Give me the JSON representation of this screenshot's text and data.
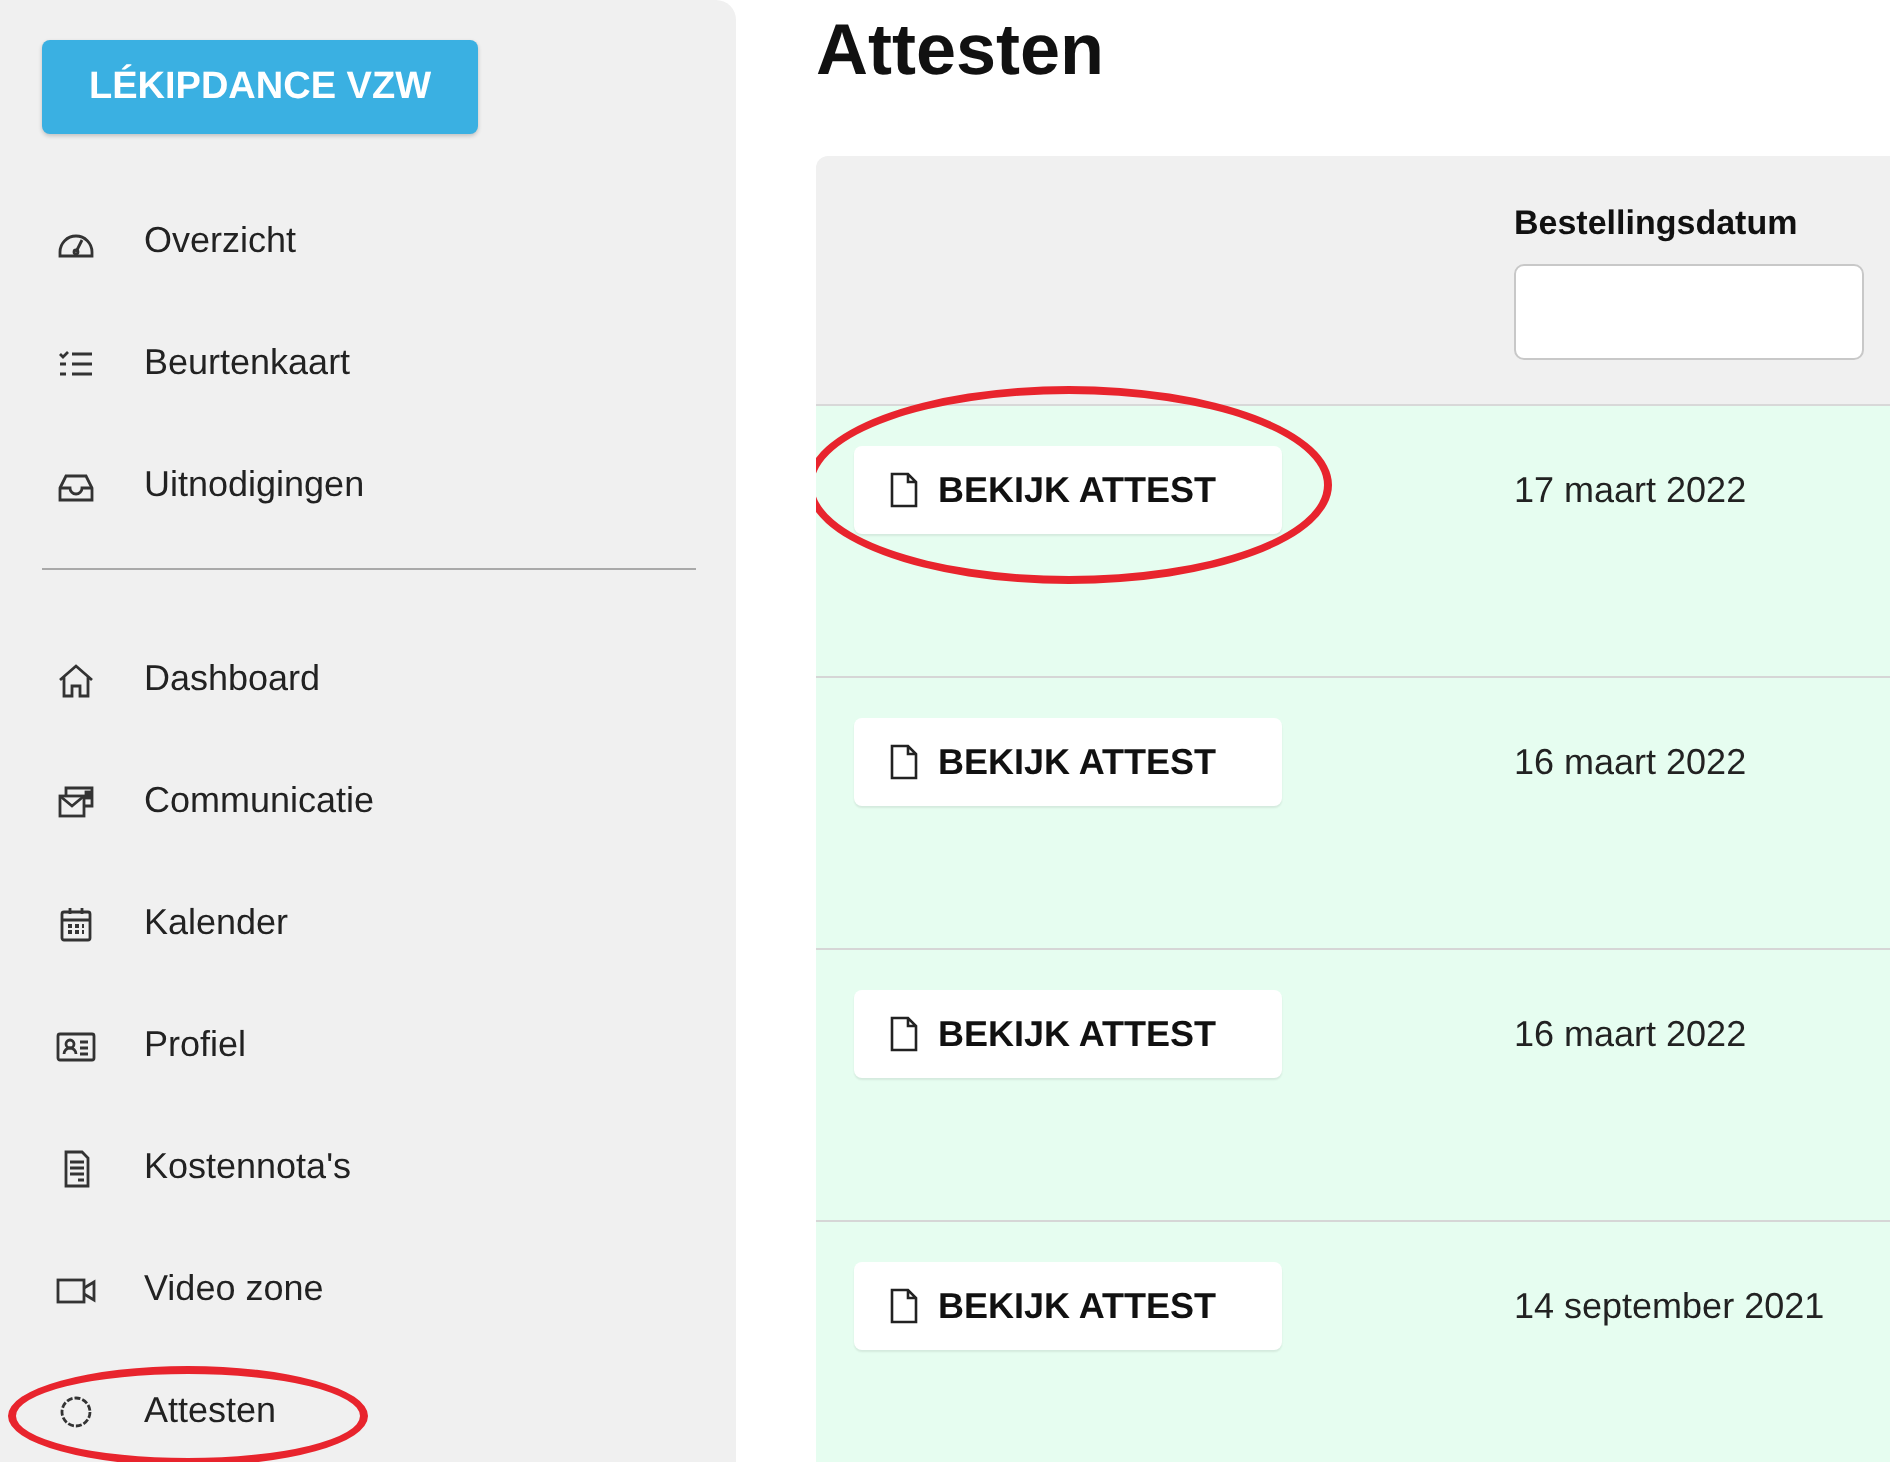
{
  "org_button": {
    "label": "LÉKIPDANCE VZW"
  },
  "nav_groups": [
    {
      "items": [
        {
          "label": "Overzicht",
          "selected": false,
          "circled": false
        },
        {
          "label": "Beurtenkaart",
          "selected": false,
          "circled": false
        },
        {
          "label": "Uitnodigingen",
          "selected": false,
          "circled": false
        }
      ]
    },
    {
      "items": [
        {
          "label": "Dashboard",
          "selected": false,
          "circled": false
        },
        {
          "label": "Communicatie",
          "selected": false,
          "circled": false
        },
        {
          "label": "Kalender",
          "selected": false,
          "circled": false
        },
        {
          "label": "Profiel",
          "selected": false,
          "circled": false
        },
        {
          "label": "Kostennota's",
          "selected": false,
          "circled": false
        },
        {
          "label": "Video zone",
          "selected": false,
          "circled": false
        },
        {
          "label": "Attesten",
          "selected": false,
          "circled": true
        }
      ]
    }
  ],
  "page_title": "Attesten",
  "table": {
    "columns": [
      {
        "kind": "action"
      },
      {
        "kind": "filter",
        "label": "Bestellingsdatum"
      }
    ],
    "rows": [
      {
        "action": "BEKIJK ATTEST",
        "date": "17 maart 2022",
        "circled": true
      },
      {
        "action": "BEKIJK ATTEST",
        "date": "16 maart 2022",
        "circled": false
      },
      {
        "action": "BEKIJK ATTEST",
        "date": "16 maart 2022",
        "circled": false
      },
      {
        "action": "BEKIJK ATTEST",
        "date": "14 september 2021",
        "circled": false
      }
    ]
  }
}
